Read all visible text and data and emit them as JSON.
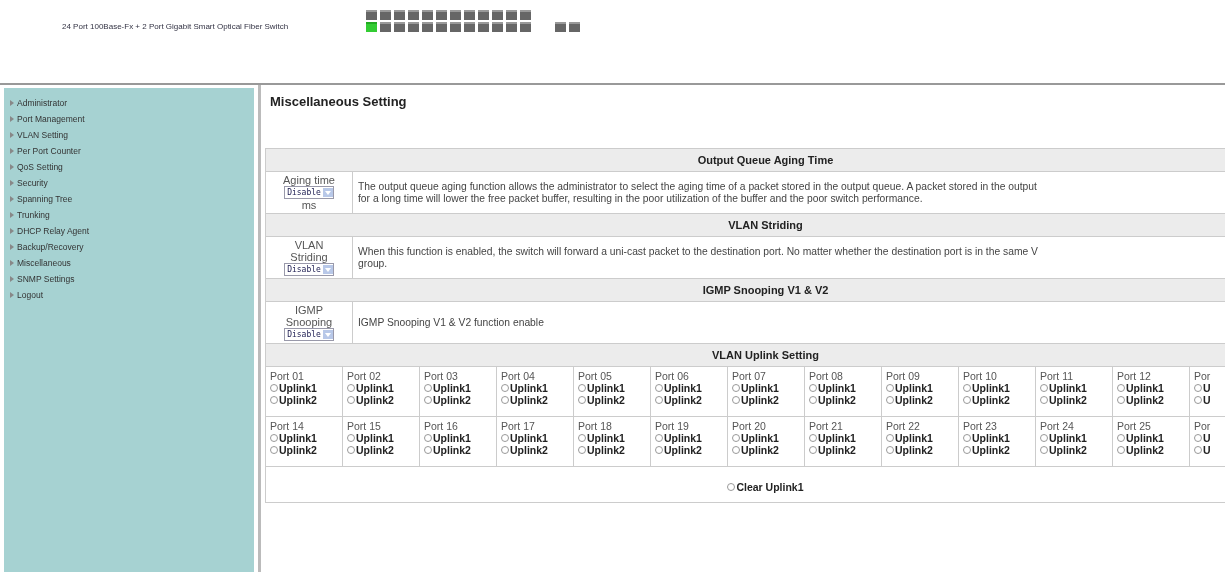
{
  "header": {
    "title": "24 Port 100Base-Fx + 2 Port Gigabit Smart Optical Fiber Switch",
    "ports": [
      {
        "on": false
      },
      {
        "on": false
      },
      {
        "on": false
      },
      {
        "on": false
      },
      {
        "on": false
      },
      {
        "on": false
      },
      {
        "on": false
      },
      {
        "on": false
      },
      {
        "on": false
      },
      {
        "on": false
      },
      {
        "on": false
      },
      {
        "on": false
      },
      {
        "on": true
      },
      {
        "on": false
      },
      {
        "on": false
      },
      {
        "on": false
      },
      {
        "on": false
      },
      {
        "on": false
      },
      {
        "on": false
      },
      {
        "on": false
      },
      {
        "on": false
      },
      {
        "on": false
      },
      {
        "on": false
      },
      {
        "on": false
      },
      {
        "on": false
      },
      {
        "on": false
      }
    ]
  },
  "sidebar": {
    "items": [
      {
        "label": "Administrator"
      },
      {
        "label": "Port Management"
      },
      {
        "label": "VLAN Setting"
      },
      {
        "label": "Per Port Counter"
      },
      {
        "label": "QoS Setting"
      },
      {
        "label": "Security"
      },
      {
        "label": "Spanning Tree"
      },
      {
        "label": "Trunking"
      },
      {
        "label": "DHCP Relay Agent"
      },
      {
        "label": "Backup/Recovery"
      },
      {
        "label": "Miscellaneous"
      },
      {
        "label": "SNMP Settings"
      },
      {
        "label": "Logout"
      }
    ]
  },
  "page_title": "Miscellaneous Setting",
  "sections": [
    {
      "heading": "Output Queue Aging Time",
      "label_lines": [
        "Aging time"
      ],
      "select": "Disable",
      "unit": "ms",
      "description_lines": [
        "The output queue aging function allows the administrator to select the aging time of a packet stored in the output queue. A packet stored in the output",
        "for a long time will lower the free packet buffer, resulting in the poor utilization of the buffer and the poor switch performance."
      ]
    },
    {
      "heading": "VLAN Striding",
      "label_lines": [
        "VLAN",
        "Striding"
      ],
      "select": "Disable",
      "description_lines": [
        "When this function is enabled, the switch will forward a uni-cast packet to the destination port. No matter whether the destination port is in the same V",
        "group."
      ]
    },
    {
      "heading": "IGMP Snooping V1 & V2",
      "label_lines": [
        "IGMP",
        "Snooping"
      ],
      "select": "Disable",
      "description_lines": [
        "IGMP Snooping V1 & V2 function enable"
      ]
    }
  ],
  "uplink": {
    "heading": "VLAN Uplink Setting",
    "rows": [
      [
        {
          "port": "Port 01",
          "options": [
            {
              "label": "Uplink1",
              "checked": false
            },
            {
              "label": "Uplink2",
              "checked": false
            }
          ]
        },
        {
          "port": "Port 02",
          "options": [
            {
              "label": "Uplink1",
              "checked": false
            },
            {
              "label": "Uplink2",
              "checked": false
            }
          ]
        },
        {
          "port": "Port 03",
          "options": [
            {
              "label": "Uplink1",
              "checked": false
            },
            {
              "label": "Uplink2",
              "checked": false
            }
          ]
        },
        {
          "port": "Port 04",
          "options": [
            {
              "label": "Uplink1",
              "checked": false
            },
            {
              "label": "Uplink2",
              "checked": false
            }
          ]
        },
        {
          "port": "Port 05",
          "options": [
            {
              "label": "Uplink1",
              "checked": false
            },
            {
              "label": "Uplink2",
              "checked": false
            }
          ]
        },
        {
          "port": "Port 06",
          "options": [
            {
              "label": "Uplink1",
              "checked": false
            },
            {
              "label": "Uplink2",
              "checked": false
            }
          ]
        },
        {
          "port": "Port 07",
          "options": [
            {
              "label": "Uplink1",
              "checked": false
            },
            {
              "label": "Uplink2",
              "checked": false
            }
          ]
        },
        {
          "port": "Port 08",
          "options": [
            {
              "label": "Uplink1",
              "checked": false
            },
            {
              "label": "Uplink2",
              "checked": false
            }
          ]
        },
        {
          "port": "Port 09",
          "options": [
            {
              "label": "Uplink1",
              "checked": false
            },
            {
              "label": "Uplink2",
              "checked": false
            }
          ]
        },
        {
          "port": "Port 10",
          "options": [
            {
              "label": "Uplink1",
              "checked": false
            },
            {
              "label": "Uplink2",
              "checked": false
            }
          ]
        },
        {
          "port": "Port 11",
          "options": [
            {
              "label": "Uplink1",
              "checked": false
            },
            {
              "label": "Uplink2",
              "checked": false
            }
          ]
        },
        {
          "port": "Port 12",
          "options": [
            {
              "label": "Uplink1",
              "checked": false
            },
            {
              "label": "Uplink2",
              "checked": false
            }
          ]
        },
        {
          "port": "Por",
          "options": [
            {
              "label": "U",
              "checked": false
            },
            {
              "label": "U",
              "checked": false
            }
          ]
        }
      ],
      [
        {
          "port": "Port 14",
          "options": [
            {
              "label": "Uplink1",
              "checked": false
            },
            {
              "label": "Uplink2",
              "checked": false
            }
          ]
        },
        {
          "port": "Port 15",
          "options": [
            {
              "label": "Uplink1",
              "checked": false
            },
            {
              "label": "Uplink2",
              "checked": false
            }
          ]
        },
        {
          "port": "Port 16",
          "options": [
            {
              "label": "Uplink1",
              "checked": false
            },
            {
              "label": "Uplink2",
              "checked": false
            }
          ]
        },
        {
          "port": "Port 17",
          "options": [
            {
              "label": "Uplink1",
              "checked": false
            },
            {
              "label": "Uplink2",
              "checked": false
            }
          ]
        },
        {
          "port": "Port 18",
          "options": [
            {
              "label": "Uplink1",
              "checked": false
            },
            {
              "label": "Uplink2",
              "checked": false
            }
          ]
        },
        {
          "port": "Port 19",
          "options": [
            {
              "label": "Uplink1",
              "checked": false
            },
            {
              "label": "Uplink2",
              "checked": false
            }
          ]
        },
        {
          "port": "Port 20",
          "options": [
            {
              "label": "Uplink1",
              "checked": false
            },
            {
              "label": "Uplink2",
              "checked": false
            }
          ]
        },
        {
          "port": "Port 21",
          "options": [
            {
              "label": "Uplink1",
              "checked": false
            },
            {
              "label": "Uplink2",
              "checked": false
            }
          ]
        },
        {
          "port": "Port 22",
          "options": [
            {
              "label": "Uplink1",
              "checked": false
            },
            {
              "label": "Uplink2",
              "checked": false
            }
          ]
        },
        {
          "port": "Port 23",
          "options": [
            {
              "label": "Uplink1",
              "checked": false
            },
            {
              "label": "Uplink2",
              "checked": false
            }
          ]
        },
        {
          "port": "Port 24",
          "options": [
            {
              "label": "Uplink1",
              "checked": false
            },
            {
              "label": "Uplink2",
              "checked": false
            }
          ]
        },
        {
          "port": "Port 25",
          "options": [
            {
              "label": "Uplink1",
              "checked": false
            },
            {
              "label": "Uplink2",
              "checked": false
            }
          ]
        },
        {
          "port": "Por",
          "options": [
            {
              "label": "U",
              "checked": false
            },
            {
              "label": "U",
              "checked": false
            }
          ]
        }
      ]
    ],
    "clear": {
      "label": "Clear Uplink1",
      "checked": false
    }
  }
}
